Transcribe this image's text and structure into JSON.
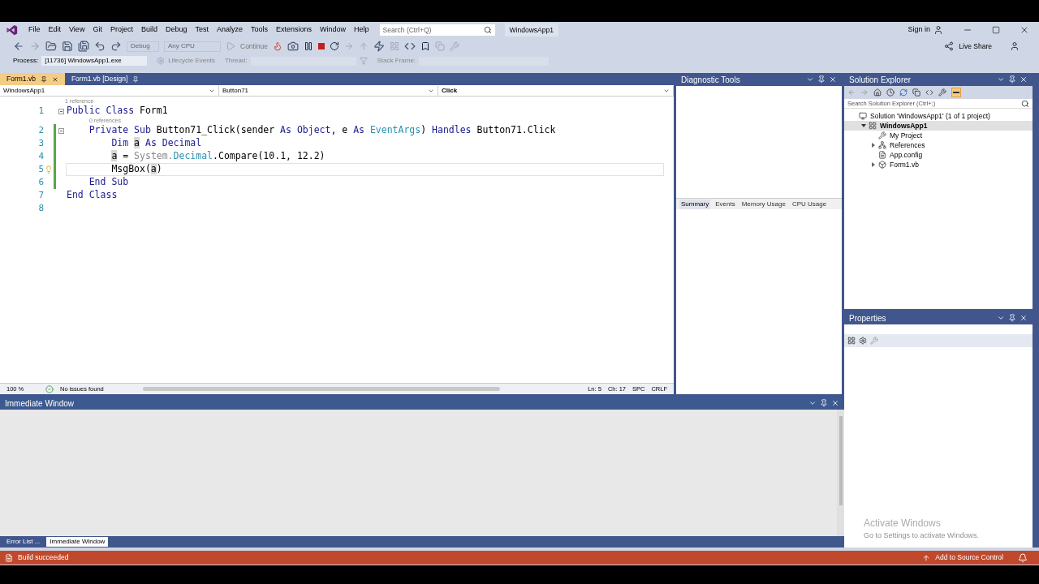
{
  "menu": [
    "File",
    "Edit",
    "View",
    "Git",
    "Project",
    "Build",
    "Debug",
    "Test",
    "Analyze",
    "Tools",
    "Extensions",
    "Window",
    "Help"
  ],
  "search": {
    "placeholder": "Search (Ctrl+Q)"
  },
  "solution_name": "WindowsApp1",
  "account": {
    "label": "Sign in"
  },
  "toolbar": {
    "configuration": "Debug",
    "platform": "Any CPU",
    "continue": "Continue",
    "live_share": "Live Share"
  },
  "debug_location": {
    "process_label": "Process:",
    "process": "[11736] WindowsApp1.exe",
    "lifecycle": "Lifecycle Events",
    "thread_label": "Thread:",
    "stack_label": "Stack Frame:"
  },
  "document_tabs": [
    {
      "label": "Form1.vb",
      "selected": true
    },
    {
      "label": "Form1.vb [Design]",
      "selected": false
    }
  ],
  "navigation_bar": [
    "WindowsApp1",
    "Button71",
    "Click"
  ],
  "code": {
    "lines": [
      {
        "number": "1",
        "lens": "1 reference",
        "changed": false,
        "current": false,
        "fold": true,
        "tokens": [
          {
            "kind": "kw",
            "text": "Public Class "
          },
          {
            "kind": "plain",
            "text": "Form1"
          }
        ]
      },
      {
        "number": "2",
        "lens": "0 references",
        "changed": true,
        "current": false,
        "fold": true,
        "tokens": [
          {
            "kind": "kw",
            "text": "    Private Sub "
          },
          {
            "kind": "plain",
            "text": "Button71_Click(sender "
          },
          {
            "kind": "kw",
            "text": "As Object"
          },
          {
            "kind": "plain",
            "text": ", e "
          },
          {
            "kind": "kw",
            "text": "As "
          },
          {
            "kind": "type",
            "text": "EventArgs"
          },
          {
            "kind": "plain",
            "text": ") "
          },
          {
            "kind": "kw",
            "text": "Handles "
          },
          {
            "kind": "plain",
            "text": "Button71.Click"
          }
        ]
      },
      {
        "number": "3",
        "changed": true,
        "current": false,
        "fold": false,
        "tokens": [
          {
            "kind": "kw",
            "text": "        Dim "
          },
          {
            "kind": "ref",
            "text": "a"
          },
          {
            "kind": "kw",
            "text": " As Decimal"
          }
        ]
      },
      {
        "number": "4",
        "changed": true,
        "current": false,
        "fold": false,
        "tokens": [
          {
            "kind": "ref",
            "text": "        a"
          },
          {
            "kind": "plain",
            "text": " = "
          },
          {
            "kind": "faded",
            "text": "System."
          },
          {
            "kind": "type",
            "text": "Decimal"
          },
          {
            "kind": "plain",
            "text": ".Compare(10.1, 12.2)"
          }
        ]
      },
      {
        "number": "5",
        "changed": true,
        "current": true,
        "fold": false,
        "bulb": true,
        "tokens": [
          {
            "kind": "plain",
            "text": "        MsgBox("
          },
          {
            "kind": "ref",
            "text": "a"
          },
          {
            "kind": "plain",
            "text": ")"
          }
        ]
      },
      {
        "number": "6",
        "changed": true,
        "current": false,
        "fold": false,
        "tokens": [
          {
            "kind": "kw",
            "text": "    End Sub"
          }
        ]
      },
      {
        "number": "7",
        "changed": false,
        "current": false,
        "fold": false,
        "tokens": [
          {
            "kind": "kw",
            "text": "End Class"
          }
        ]
      },
      {
        "number": "8",
        "changed": false,
        "current": false,
        "fold": false
      }
    ]
  },
  "editor_status": {
    "zoom": "100 %",
    "issues": "No issues found",
    "line": "Ln: 5",
    "column": "Ch: 17",
    "whitespace": "SPC",
    "line_ending": "CRLF"
  },
  "diagnostic_tools": {
    "title": "Diagnostic Tools",
    "tabs": [
      {
        "label": "Summary",
        "selected": true
      },
      {
        "label": "Events",
        "selected": false
      },
      {
        "label": "Memory Usage",
        "selected": false
      },
      {
        "label": "CPU Usage",
        "selected": false
      }
    ]
  },
  "solution_explorer": {
    "title": "Solution Explorer",
    "search_placeholder": "Search Solution Explorer (Ctrl+;)",
    "tree": [
      {
        "kind": "solution",
        "label": "Solution 'WindowsApp1' (1 of 1 project)",
        "selected": false,
        "children": [
          {
            "kind": "project",
            "label": "WindowsApp1",
            "selected": true,
            "expanded": true,
            "children": [
              {
                "kind": "settings",
                "label": "My Project",
                "selected": false
              },
              {
                "kind": "references",
                "label": "References",
                "selected": false,
                "expanded": false
              },
              {
                "kind": "config",
                "label": "App.config",
                "selected": false
              },
              {
                "kind": "form",
                "label": "Form1.vb",
                "selected": false,
                "expanded": false
              }
            ]
          }
        ]
      }
    ]
  },
  "properties": {
    "title": "Properties"
  },
  "immediate_window": {
    "title": "Immediate Window"
  },
  "bottom_tabs": [
    {
      "label": "Error List ...",
      "selected": false
    },
    {
      "label": "Immediate Window",
      "selected": true
    }
  ],
  "activation": {
    "title": "Activate Windows",
    "subtitle": "Go to Settings to activate Windows."
  },
  "status_bar": {
    "message": "Build succeeded",
    "source_control": "Add to Source Control"
  }
}
